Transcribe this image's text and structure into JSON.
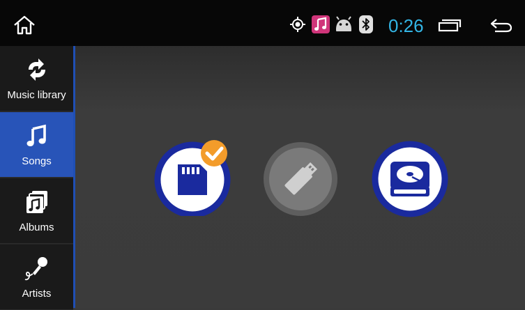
{
  "statusbar": {
    "icons": [
      "home-icon",
      "location-icon",
      "music-note-icon",
      "android-icon",
      "bluetooth-icon",
      "recent-apps-icon",
      "back-icon"
    ],
    "time": "0:26"
  },
  "sidebar": {
    "items": [
      {
        "label": "Music library",
        "icon": "sync-icon",
        "active": false
      },
      {
        "label": "Songs",
        "icon": "music-note-icon",
        "active": true
      },
      {
        "label": "Albums",
        "icon": "albums-icon",
        "active": false
      },
      {
        "label": "Artists",
        "icon": "microphone-icon",
        "active": false
      }
    ]
  },
  "sources": [
    {
      "name": "SD card",
      "icon": "sd-card-icon",
      "selected": true,
      "enabled": true
    },
    {
      "name": "USB",
      "icon": "usb-drive-icon",
      "selected": false,
      "enabled": false
    },
    {
      "name": "Hard disk",
      "icon": "hard-disk-icon",
      "selected": false,
      "enabled": true
    }
  ],
  "colors": {
    "accent": "#33b5e5",
    "sidebar_active": "#2854b8",
    "source_ring": "#1a2a9e",
    "check_badge": "#f39c2a",
    "disabled_source": "#7a7a7a"
  }
}
